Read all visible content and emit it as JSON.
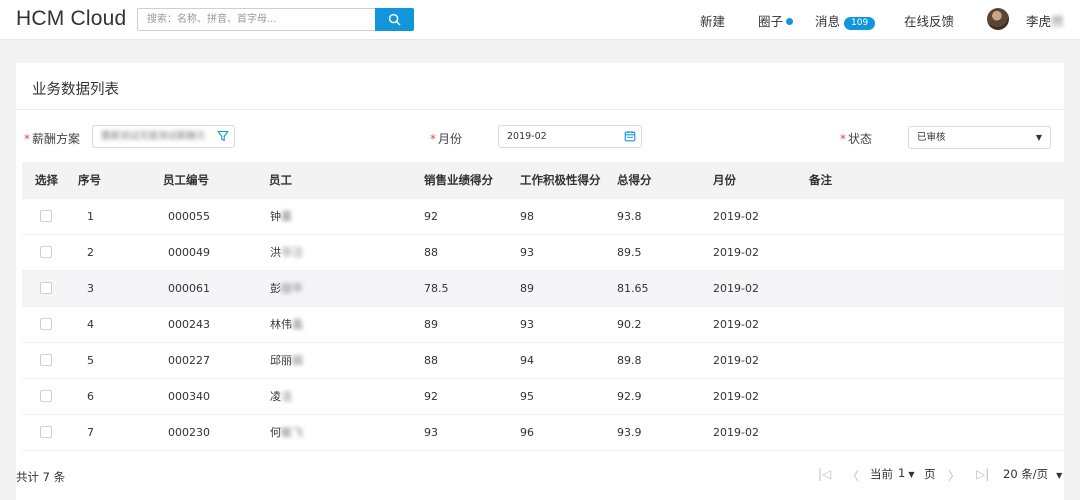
{
  "header": {
    "logo": "HCM Cloud",
    "search_placeholder": "搜索：名称、拼音、首字母...",
    "nav": {
      "new": "新建",
      "circle": "圈子",
      "messages": "消息",
      "messages_count": "109",
      "feedback": "在线反馈"
    },
    "user": {
      "name_visible": "李虎",
      "name_blurred": "然"
    }
  },
  "card": {
    "title": "业务数据列表",
    "filters": {
      "plan_label": "薪酬方案",
      "plan_value_blurred": "蕙薪测试月度测试薪酬方",
      "month_label": "月份",
      "month_value": "2019-02",
      "status_label": "状态",
      "status_value": "已审核"
    },
    "table": {
      "columns": [
        "选择",
        "序号",
        "员工编号",
        "员工",
        "销售业绩得分",
        "工作积极性得分",
        "总得分",
        "月份",
        "备注"
      ],
      "rows": [
        {
          "seq": "1",
          "emp_no": "000055",
          "name": "钟",
          "name_blur": "薰",
          "sales": "92",
          "effort": "98",
          "total": "93.8",
          "month": "2019-02",
          "note": ""
        },
        {
          "seq": "2",
          "emp_no": "000049",
          "name": "洪",
          "name_blur": "华汪",
          "sales": "88",
          "effort": "93",
          "total": "89.5",
          "month": "2019-02",
          "note": ""
        },
        {
          "seq": "3",
          "emp_no": "000061",
          "name": "彭",
          "name_blur": "丽平",
          "sales": "78.5",
          "effort": "89",
          "total": "81.65",
          "month": "2019-02",
          "note": ""
        },
        {
          "seq": "4",
          "emp_no": "000243",
          "name": "林伟",
          "name_blur": "鑫",
          "sales": "89",
          "effort": "93",
          "total": "90.2",
          "month": "2019-02",
          "note": ""
        },
        {
          "seq": "5",
          "emp_no": "000227",
          "name": "邱丽",
          "name_blur": "娟",
          "sales": "88",
          "effort": "94",
          "total": "89.8",
          "month": "2019-02",
          "note": ""
        },
        {
          "seq": "6",
          "emp_no": "000340",
          "name": "凌",
          "name_blur": "洁",
          "sales": "92",
          "effort": "95",
          "total": "92.9",
          "month": "2019-02",
          "note": ""
        },
        {
          "seq": "7",
          "emp_no": "000230",
          "name": "何",
          "name_blur": "敏飞",
          "sales": "93",
          "effort": "96",
          "total": "93.9",
          "month": "2019-02",
          "note": ""
        }
      ]
    }
  },
  "footer": {
    "total": "共计 7 条",
    "current_label": "当前",
    "current_page": "1",
    "page_unit": "页",
    "page_size": "20 条/页"
  },
  "colors": {
    "accent": "#1296db",
    "required": "#e84b3c"
  }
}
